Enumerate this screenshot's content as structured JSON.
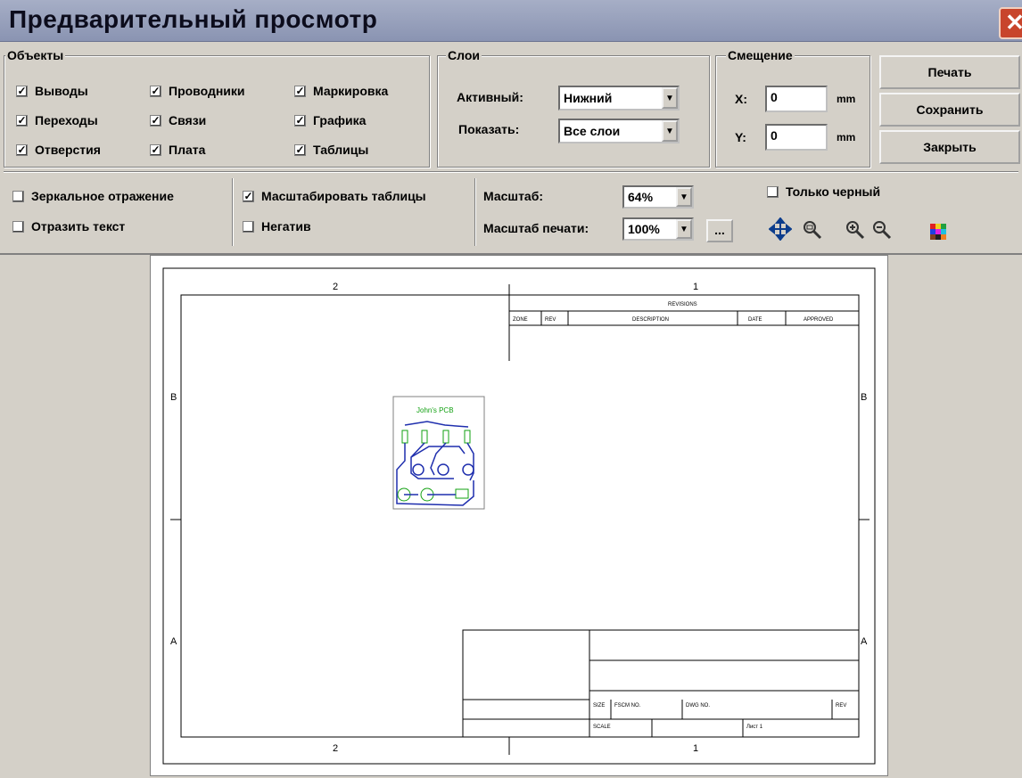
{
  "window": {
    "title": "Предварительный просмотр",
    "close_glyph": "✕"
  },
  "objects": {
    "label": "Объекты",
    "items": [
      {
        "label": "Выводы",
        "checked": true
      },
      {
        "label": "Проводники",
        "checked": true
      },
      {
        "label": "Маркировка",
        "checked": true
      },
      {
        "label": "Переходы",
        "checked": true
      },
      {
        "label": "Связи",
        "checked": true
      },
      {
        "label": "Графика",
        "checked": true
      },
      {
        "label": "Отверстия",
        "checked": true
      },
      {
        "label": "Плата",
        "checked": true
      },
      {
        "label": "Таблицы",
        "checked": true
      }
    ]
  },
  "layers": {
    "label": "Слои",
    "active_label": "Активный:",
    "active_value": "Нижний",
    "show_label": "Показать:",
    "show_value": "Все слои"
  },
  "offset": {
    "label": "Смещение",
    "x_label": "X:",
    "x_value": "0",
    "y_label": "Y:",
    "y_value": "0",
    "unit": "mm"
  },
  "actions": {
    "print": "Печать",
    "save": "Сохранить",
    "close": "Закрыть"
  },
  "options": {
    "mirror": {
      "label": "Зеркальное отражение",
      "checked": false
    },
    "mirror_text": {
      "label": "Отразить текст",
      "checked": false
    },
    "scale_tables": {
      "label": "Масштабировать таблицы",
      "checked": true
    },
    "negative": {
      "label": "Негатив",
      "checked": false
    },
    "black_only": {
      "label": "Только черный",
      "checked": false
    }
  },
  "scale": {
    "label": "Масштаб:",
    "value": "64%",
    "print_label": "Масштаб печати:",
    "print_value": "100%",
    "more_button": "..."
  },
  "tools": [
    "move-icon",
    "zoom-window-icon",
    "zoom-in-icon",
    "zoom-out-icon",
    "color-palette-icon"
  ],
  "check_glyph": "✓",
  "dropdown_glyph": "▼",
  "drawing": {
    "zone_top_left": "2",
    "zone_top_right": "1",
    "zone_bottom_left": "2",
    "zone_bottom_right": "1",
    "row_b": "B",
    "row_a": "A",
    "revisions": "REVISIONS",
    "rev_cols": [
      "ZONE",
      "REV",
      "DESCRIPTION",
      "DATE",
      "APPROVED"
    ],
    "title_block": {
      "size": "SIZE",
      "fscm": "FSCM NO.",
      "dwg": "DWG NO.",
      "rev": "REV",
      "scale": "SCALE",
      "sheet": "Лист 1"
    },
    "pcb_title": "John's PCB"
  },
  "colors": {
    "pcb_blue": "#1f2fae",
    "pcb_green": "#12a012",
    "titlebar": "#9aa3bd"
  }
}
